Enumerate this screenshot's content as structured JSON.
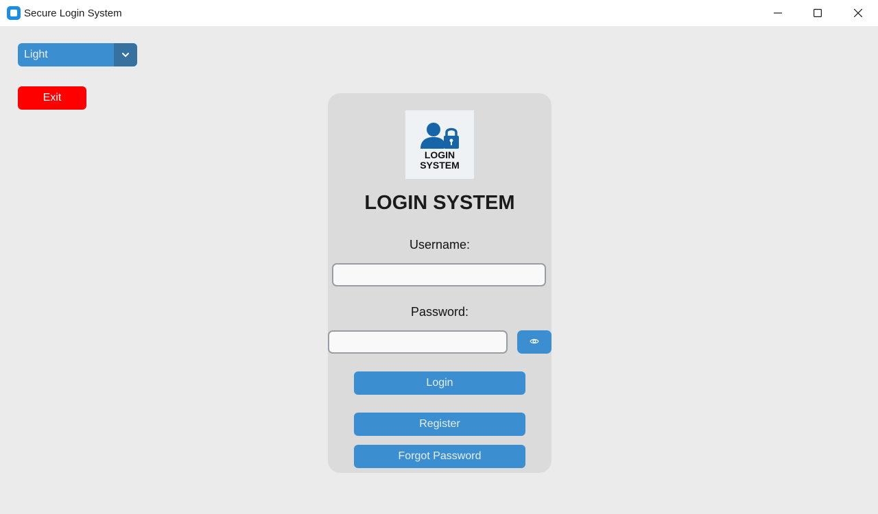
{
  "window": {
    "title": "Secure Login System"
  },
  "theme_select": {
    "value": "Light"
  },
  "exit_label": "Exit",
  "card": {
    "logo_line1": "LOGIN",
    "logo_line2": "SYSTEM",
    "heading": "LOGIN SYSTEM",
    "username_label": "Username:",
    "username_value": "",
    "password_label": "Password:",
    "password_value": "",
    "login_label": "Login",
    "register_label": "Register",
    "forgot_label": "Forgot Password"
  },
  "colors": {
    "accent": "#3b8ed0",
    "accent_dark": "#36719f",
    "exit": "#ff0000",
    "background": "#ebebeb",
    "card": "#dbdbdb",
    "logo_blue": "#1565a8"
  },
  "icons": {
    "app": "app-icon",
    "minimize": "minimize-icon",
    "maximize": "maximize-icon",
    "close": "close-icon",
    "dropdown": "chevron-down-icon",
    "show_password": "eye-icon",
    "logo": "user-lock-icon"
  }
}
